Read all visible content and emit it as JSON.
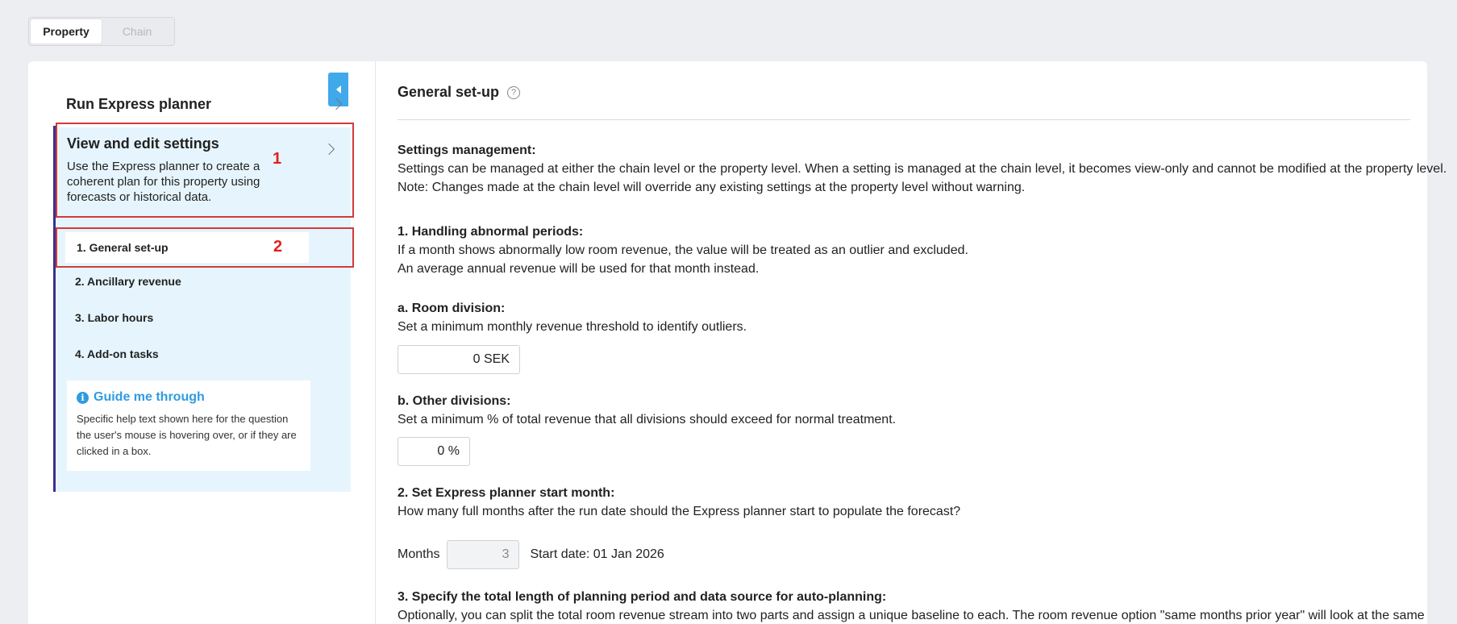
{
  "tabs": {
    "property": "Property",
    "chain": "Chain"
  },
  "sidebar": {
    "run_label": "Run Express planner",
    "settings_title": "View and edit settings",
    "settings_desc": "Use the Express planner to create a coherent plan for this property using forecasts or historical data.",
    "annotation_1": "1",
    "annotation_2": "2",
    "steps": [
      {
        "label": "1. General set-up"
      },
      {
        "label": "2. Ancillary revenue"
      },
      {
        "label": "3. Labor hours"
      },
      {
        "label": "4. Add-on tasks"
      }
    ],
    "guide_title": "Guide me through",
    "guide_text": "Specific help text shown here for the question the user's mouse is hovering over, or if they are clicked in a box."
  },
  "main": {
    "title": "General set-up",
    "settings_mgmt_heading": "Settings management:",
    "settings_mgmt_line1": "Settings can be managed at either the chain level or the property level. When a setting is managed at the chain level, it becomes view-only and cannot be modified at the property level.",
    "settings_mgmt_line2": "Note: Changes made at the chain level will override any existing settings at the property level without warning.",
    "s1_heading": "1.  Handling abnormal periods:",
    "s1_line1": "If a month shows abnormally low room revenue, the value will be treated as an outlier and excluded.",
    "s1_line2": "An average annual revenue will be used for that month instead.",
    "a_heading": "a.  Room division:",
    "a_text": "Set a minimum monthly revenue threshold to identify outliers.",
    "a_value": "0 SEK",
    "b_heading": "b.  Other divisions:",
    "b_text": "Set a minimum % of total revenue that all divisions should exceed for normal treatment.",
    "b_value": "0 %",
    "s2_heading": "2.  Set Express planner start month:",
    "s2_text": "How many full months after the run date should the Express planner start to populate the forecast?",
    "months_label": "Months",
    "months_value": "3",
    "start_date": "Start date: 01 Jan 2026",
    "s3_heading": "3.  Specify the total length of planning period and data source for auto-planning:",
    "s3_text": "Optionally, you can split the total room revenue stream into two parts and assign a unique baseline to each. The room revenue option \"same months prior year\" will look at the same"
  },
  "colors": {
    "accent": "#3fa9ea",
    "annotation": "#d23a3a",
    "sidebar_bg": "#e6f5fd",
    "guide_title": "#2f9be0",
    "left_accent": "#3e2e8d"
  }
}
